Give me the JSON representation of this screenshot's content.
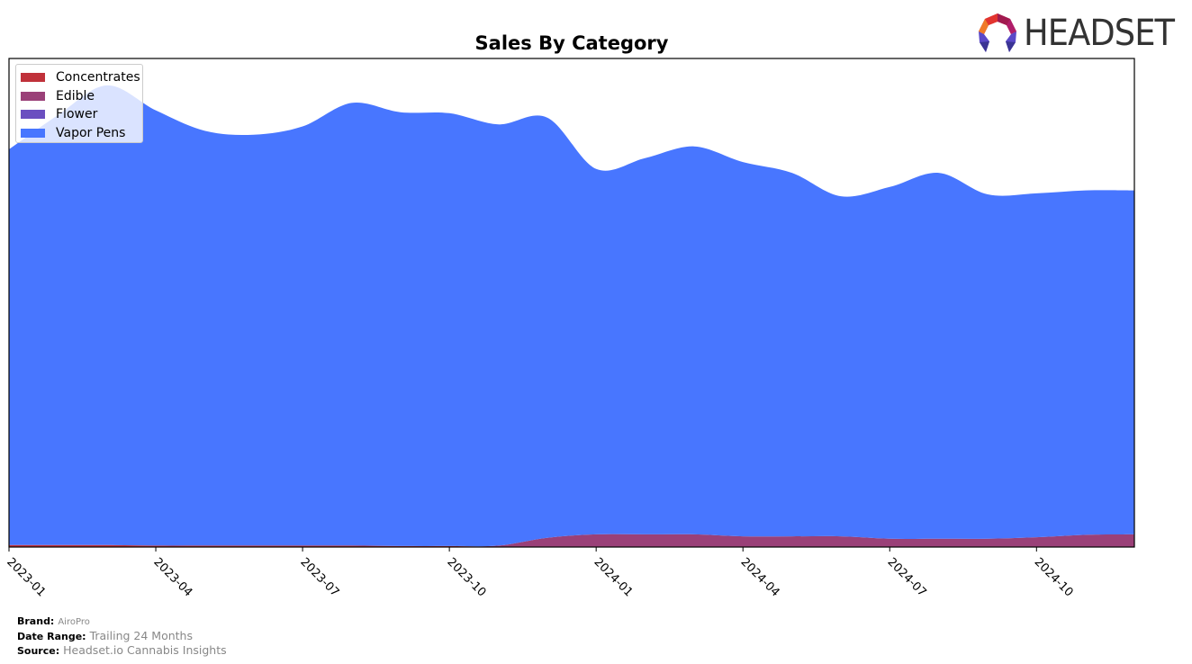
{
  "colors": {
    "Concentrates": "#c0313a",
    "Edible": "#9a4078",
    "Flower": "#6b4fc0",
    "Vapor Pens": "#4876ff",
    "legend_vapor_overlay": "#d6e0ff"
  },
  "logo": {
    "text": "HEADSET"
  },
  "footer": {
    "brand_label": "Brand:",
    "brand_value": "AiroPro",
    "date_range_label": "Date Range:",
    "date_range_value": "Trailing 24 Months",
    "source_label": "Source:",
    "source_value": "Headset.io Cannabis Insights"
  },
  "chart_data": {
    "type": "area",
    "stacked": true,
    "title": "Sales By Category",
    "xlabel": "",
    "ylabel": "",
    "x": [
      "2023-01",
      "2023-02",
      "2023-03",
      "2023-04",
      "2023-05",
      "2023-06",
      "2023-07",
      "2023-08",
      "2023-09",
      "2023-10",
      "2023-11",
      "2023-12",
      "2024-01",
      "2024-02",
      "2024-03",
      "2024-04",
      "2024-05",
      "2024-06",
      "2024-07",
      "2024-08",
      "2024-09",
      "2024-10",
      "2024-11",
      "2024-12"
    ],
    "x_tick_labels": [
      "2023-01",
      "2023-04",
      "2023-07",
      "2023-10",
      "2024-01",
      "2024-04",
      "2024-07",
      "2024-10"
    ],
    "y_ticks_visible": false,
    "ylim": [
      0,
      100
    ],
    "grid": false,
    "legend_position": "top-left",
    "series": [
      {
        "name": "Concentrates",
        "values": [
          0.4,
          0.4,
          0.4,
          0.3,
          0.3,
          0.3,
          0.3,
          0.3,
          0.2,
          0.2,
          0,
          0,
          0,
          0,
          0,
          0,
          0,
          0,
          0,
          0,
          0,
          0,
          0,
          0
        ]
      },
      {
        "name": "Edible",
        "values": [
          0,
          0,
          0,
          0,
          0,
          0,
          0,
          0,
          0,
          0,
          0.3,
          1.9,
          2.6,
          2.6,
          2.6,
          2.2,
          2.2,
          2.2,
          1.7,
          1.7,
          1.7,
          2.0,
          2.5,
          2.6
        ]
      },
      {
        "name": "Flower",
        "values": [
          0,
          0,
          0,
          0,
          0,
          0,
          0,
          0,
          0,
          0,
          0,
          0,
          0,
          0,
          0,
          0,
          0,
          0,
          0,
          0,
          0,
          0,
          0,
          0
        ]
      },
      {
        "name": "Vapor Pens",
        "values": [
          81.0,
          88.0,
          94.1,
          89.1,
          84.9,
          84.1,
          85.8,
          90.6,
          88.8,
          88.6,
          86.2,
          86.0,
          74.8,
          77.0,
          79.4,
          76.6,
          74.4,
          69.6,
          72.0,
          74.9,
          70.5,
          70.4,
          70.5,
          70.4
        ]
      }
    ]
  }
}
